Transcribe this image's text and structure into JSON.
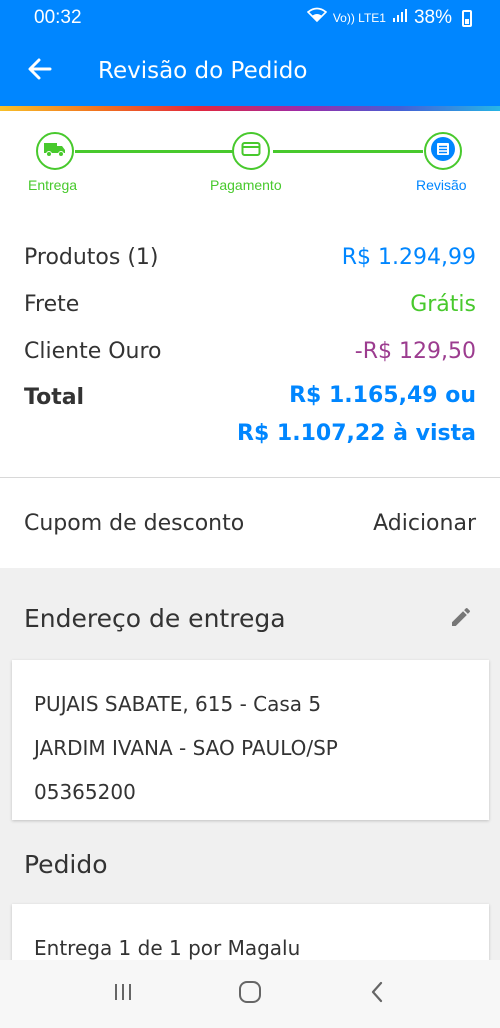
{
  "status_bar": {
    "time": "00:32",
    "network_label": "Vo)) LTE1",
    "battery": "38%"
  },
  "app_bar": {
    "title": "Revisão do Pedido"
  },
  "stepper": {
    "steps": [
      {
        "label": "Entrega",
        "icon": "truck-icon",
        "state": "done"
      },
      {
        "label": "Pagamento",
        "icon": "card-icon",
        "state": "done"
      },
      {
        "label": "Revisão",
        "icon": "list-icon",
        "state": "active"
      }
    ]
  },
  "summary": {
    "products_label": "Produtos (1)",
    "products_value": "R$ 1.294,99",
    "shipping_label": "Frete",
    "shipping_value": "Grátis",
    "gold_label": "Cliente Ouro",
    "gold_value": "-R$ 129,50",
    "total_label": "Total",
    "total_value": "R$ 1.165,49 ou",
    "total_cash": "R$ 1.107,22 à vista"
  },
  "coupon": {
    "label": "Cupom de desconto",
    "action": "Adicionar"
  },
  "address": {
    "title": "Endereço de entrega",
    "line1": "PUJAIS SABATE, 615 - Casa 5",
    "line2": "JARDIM IVANA - SAO PAULO/SP",
    "line3": "05365200"
  },
  "order": {
    "title": "Pedido",
    "delivery_text": "Entrega 1 de 1 por Magalu"
  },
  "colors": {
    "primary": "#0086ff",
    "success": "#48c92d",
    "discount": "#9c3c8f"
  }
}
